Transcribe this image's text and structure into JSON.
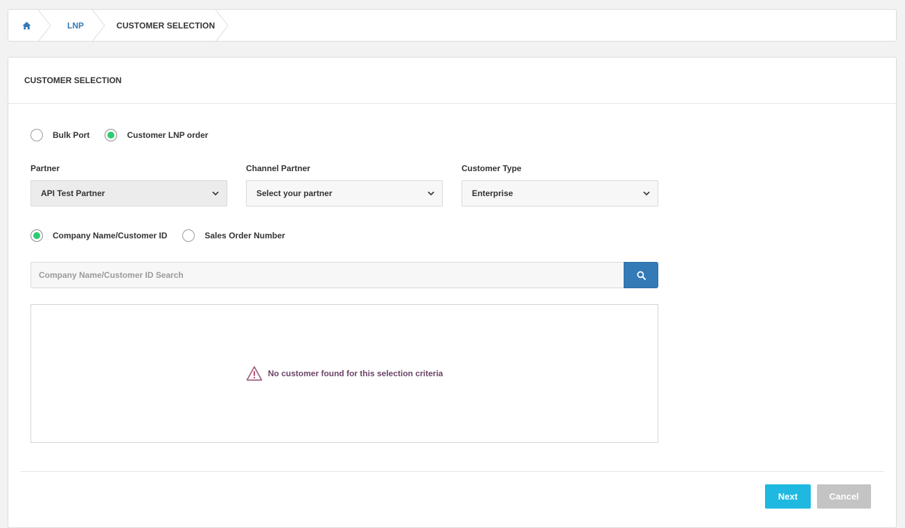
{
  "breadcrumb": {
    "home_icon": "home-icon",
    "items": [
      "LNP",
      "CUSTOMER SELECTION"
    ]
  },
  "panel": {
    "title": "CUSTOMER SELECTION"
  },
  "order_type": {
    "options": [
      "Bulk Port",
      "Customer LNP order"
    ],
    "selected": "Customer LNP order"
  },
  "fields": {
    "partner": {
      "label": "Partner",
      "value": "API Test Partner"
    },
    "channel_partner": {
      "label": "Channel Partner",
      "value": "Select your partner"
    },
    "customer_type": {
      "label": "Customer Type",
      "value": "Enterprise"
    }
  },
  "search_mode": {
    "options": [
      "Company Name/Customer ID",
      "Sales Order Number"
    ],
    "selected": "Company Name/Customer ID"
  },
  "search": {
    "placeholder": "Company Name/Customer ID Search",
    "value": "",
    "icon": "search-icon"
  },
  "results": {
    "empty_message": "No customer found for this selection criteria",
    "icon": "warning-icon"
  },
  "actions": {
    "next_label": "Next",
    "cancel_label": "Cancel"
  },
  "colors": {
    "link": "#337ab7",
    "radio_checked": "#2ecc71",
    "primary_button": "#1fb8e0",
    "search_button": "#337ab7",
    "cancel_button": "#c4c4c4",
    "empty_text": "#6b4466"
  }
}
